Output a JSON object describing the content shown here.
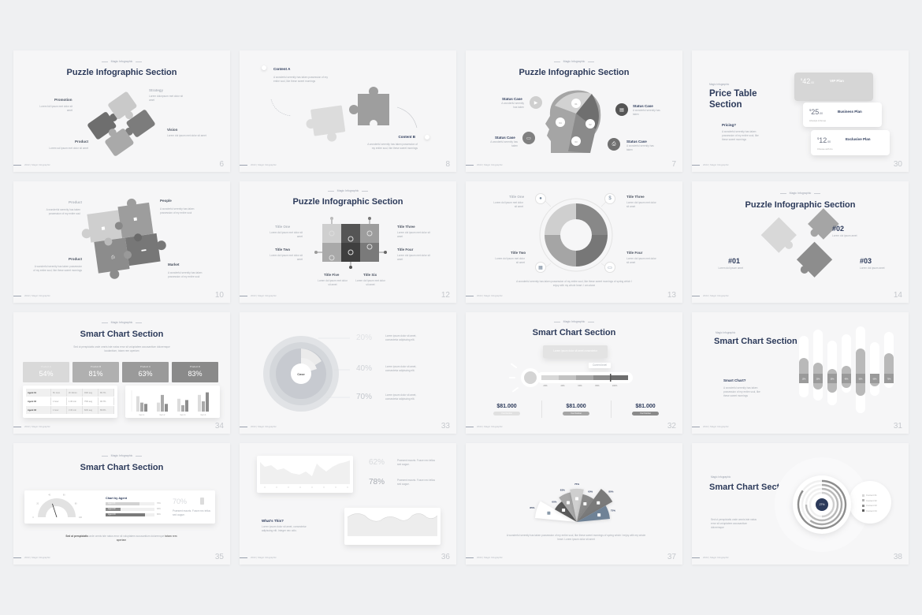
{
  "slides": [
    {
      "page": "6",
      "subtitle": "Magic Infographic",
      "title": "Puzzle Infographic Section",
      "labels": [
        {
          "title": "Promotion",
          "text": "Lorem full ipsum met dolor sit amet"
        },
        {
          "title": "Strategy",
          "text": "Lorem dolorpsum met dolor sit amet"
        },
        {
          "title": "Vision",
          "text": "Lorem dol ipsum met dolor sit amet"
        },
        {
          "title": "Product",
          "text": "Lorem sol ipsum met dolor sit amet"
        }
      ],
      "footer": "2022 | Magic Infographic"
    },
    {
      "page": "8",
      "labels": [
        {
          "title": "Content A",
          "text": "A wonderful serenity has taken possession of my entire soul, like these sweet mornings"
        },
        {
          "title": "Content B",
          "text": "A wonderful serenity has taken possession of my entire soul, like these sweet mornings"
        }
      ],
      "footer": "2022 | Magic Infographic"
    },
    {
      "page": "7",
      "subtitle": "Magic Infographic",
      "title": "Puzzle Infographic Section",
      "labels": [
        {
          "title": "Status Case",
          "text": "A wonderful serenity has taken"
        },
        {
          "title": "Status Case",
          "text": "A wonderful serenity has taken"
        },
        {
          "title": "Status Case",
          "text": "A wonderful serenity has taken"
        },
        {
          "title": "Status Case",
          "text": "A wonderful serenity has taken"
        }
      ],
      "head_numbers": [
        "01",
        "02",
        "03",
        "04"
      ],
      "footer": "2022 | Magic Infographic"
    },
    {
      "page": "30",
      "subtitle": "Magic Infographic",
      "title_line1": "Price Table",
      "title_line2": "Section",
      "question": "Pricing?",
      "text": "A wonderful serenity has taken possession of my entire soul, like these sweet mornings",
      "plans": [
        {
          "currency": "$",
          "price": "42",
          "cents": ".00",
          "name": "VIP Plan",
          "note": "Lifestyle 1/Group"
        },
        {
          "currency": "$",
          "price": "25",
          "cents": ".00",
          "name": "Business Plan",
          "note": "Lifestyle 1/Group"
        },
        {
          "currency": "$",
          "price": "12",
          "cents": ".00",
          "name": "Exclusive Plan",
          "note": "Choose with Us"
        }
      ],
      "footer": "2022 | Magic Infographic"
    },
    {
      "page": "10",
      "labels": [
        {
          "title": "Product",
          "text": "A wonderful serenity has taken possession of my entire soul"
        },
        {
          "title": "People",
          "text": "A wonderful serenity has taken possession of my entire soul"
        },
        {
          "title": "Product",
          "text": "A wonderful serenity has taken possession of my entire soul, like these sweet mornings"
        },
        {
          "title": "Market",
          "text": "A wonderful serenity has taken possession of my entire soul"
        }
      ],
      "footer": "2022 | Magic Infographic"
    },
    {
      "page": "12",
      "subtitle": "Magic Infographic",
      "title": "Puzzle Infographic Section",
      "labels": [
        {
          "title": "Title One",
          "text": "Lorem dol ipsum met dolor sit amet"
        },
        {
          "title": "Title Two",
          "text": "Lorem dol ipsum met dolor sit amet"
        },
        {
          "title": "Title Three",
          "text": "Lorem dol ipsum met dolor sit amet"
        },
        {
          "title": "Title Four",
          "text": "Lorem dol ipsum met dolor sit amet"
        },
        {
          "title": "Title Five",
          "text": "Lorem dol ipsum met dolor sit amet"
        },
        {
          "title": "Title Six",
          "text": "Lorem dol ipsum met dolor sit amet"
        }
      ],
      "footer": "2022 | Magic Infographic"
    },
    {
      "page": "13",
      "labels": [
        {
          "title": "Title One",
          "text": "Lorem dol ipsum met dolor sit amet"
        },
        {
          "title": "Title Two",
          "text": "Lorem dol ipsum met dolor sit amet"
        },
        {
          "title": "Title Three",
          "text": "Lorem dol ipsum met dolor sit amet"
        },
        {
          "title": "Title Four",
          "text": "Lorem dol ipsum met dolor sit amet"
        }
      ],
      "caption": "A wonderful serenity has taken possession of my entire soul, like these sweet mornings of spring which I enjoy with my whole heart. I am alone",
      "footer": "2022 | Magic Infographic"
    },
    {
      "page": "14",
      "subtitle": "Magic Infographic",
      "title": "Puzzle Infographic Section",
      "labels": [
        {
          "title": "#01",
          "text": "Lorem dol ipsum amet"
        },
        {
          "title": "#02",
          "text": "Lorem dol ipsum amet"
        },
        {
          "title": "#03",
          "text": "Lorem dol ipsum amet"
        }
      ],
      "footer": "2022 | Magic Infographic"
    },
    {
      "page": "34",
      "subtitle": "Magic Infographic",
      "title": "Smart Chart Section",
      "text": "Sed ut perspiciatis unde omnis iste natus error sit voluptatem accusantium doloremque laudantium, totam rem aperiam",
      "stats": [
        {
          "label": "Product A",
          "value": "54%"
        },
        {
          "label": "Product B",
          "value": "81%"
        },
        {
          "label": "Product C",
          "value": "63%"
        },
        {
          "label": "Product D",
          "value": "83%"
        }
      ],
      "table_rows": [
        [
          "Agent 01",
          "5h 1min",
          "2h 30min",
          "93% avg",
          "85.7%"
        ],
        [
          "Agent 02",
          "1 hour",
          "1 30 min",
          "75% avg",
          "96.7%"
        ],
        [
          "Agent 03",
          "1 hour",
          "3 30 min",
          "82% avg",
          "89.5%"
        ]
      ],
      "bar_groups": [
        "Item 1",
        "Item 2",
        "Item 3",
        "Item 4"
      ],
      "bar_values": [
        [
          6,
          3.5,
          3
        ],
        [
          3.5,
          6.5,
          3
        ],
        [
          5,
          2.5,
          4.5
        ],
        [
          6.5,
          4,
          7.5
        ]
      ],
      "footer": "2022 | Magic Infographic"
    },
    {
      "page": "33",
      "center_label": "Case",
      "rows": [
        {
          "value": "20%",
          "text": "Lorem ipsum dolor sit amet, consectetur adipiscing elit."
        },
        {
          "value": "40%",
          "text": "Lorem ipsum dolor sit amet, consectetur adipiscing elit."
        },
        {
          "value": "70%",
          "text": "Lorem ipsum dolor sit amet, consectetur adipiscing elit."
        }
      ],
      "footer": "2022 | Magic Infographic"
    },
    {
      "page": "32",
      "subtitle": "Magic Infographic",
      "title": "Smart Chart Section",
      "box_text": "Lorem ipsum dolor sit amet consectetur",
      "tooltip": "Current level",
      "scale": [
        "20%",
        "40%",
        "60%",
        "80%",
        "100%"
      ],
      "level": 0.8,
      "amounts": [
        {
          "value": "$81.000",
          "pill": "Your Number"
        },
        {
          "value": "$81.000",
          "pill": "Your Number"
        },
        {
          "value": "$81.000",
          "pill": "Your Number"
        }
      ],
      "footer": "2022 | Magic Infographic"
    },
    {
      "page": "31",
      "subtitle": "Magic Infographic",
      "title": "Smart Chart  Section",
      "question": "Smart Chart?",
      "text": "A wonderful serenity has taken possession of my entire soul, like these sweet mornings",
      "pill_labels": [
        "10%",
        "20%",
        "30%",
        "40%",
        "50%",
        "60%",
        "70%"
      ],
      "footer": "2022 | Magic Infographic"
    },
    {
      "page": "35",
      "subtitle": "Magic Infographic",
      "title": "Smart Chart Section",
      "gauge_ticks": [
        "0",
        "20",
        "40",
        "60",
        "80",
        "100"
      ],
      "gauge_value": 40,
      "chart_title": "Chart by Agent",
      "agents": [
        {
          "name": "Agent 01",
          "value": "70%",
          "pct": 0.7
        },
        {
          "name": "Agent 02",
          "value": "30%",
          "pct": 0.3
        },
        {
          "name": "Agent 03",
          "value": "80%",
          "pct": 0.8
        }
      ],
      "big_value": "70%",
      "big_text": "Praesent mauris. Fusce nec tellus sed augue.",
      "caption_bold": "Sed ut perspiciatis",
      "caption": "unde omnis iste natus error sit voluptatem accusantium doloremque",
      "caption_end": "totam rem aperiam",
      "footer": "2022 | Magic Infographic"
    },
    {
      "page": "36",
      "stats": [
        {
          "value": "62%",
          "text": "Praesent mauris. Fusce nec tellus sed augue."
        },
        {
          "value": "78%",
          "text": "Praesent mauris. Fusce nec tellus sed augue."
        }
      ],
      "question": "What's This?",
      "text": "Lorem ipsum dolor sit amet, consectetur adipiscing elit. Integer nec odio.",
      "footer": "2022 | Magic Infographic"
    },
    {
      "page": "37",
      "fan": [
        {
          "value": "85%",
          "color": "#ffffff",
          "icon": "briefcase"
        },
        {
          "value": "60%",
          "color": "#5a5a5a",
          "icon": "chart"
        },
        {
          "value": "63%",
          "color": "#a8a8a8",
          "icon": "person"
        },
        {
          "value": "75%",
          "color": "#cfcfcf",
          "icon": "calendar"
        },
        {
          "value": "60%",
          "color": "#8a8a8a",
          "icon": "pie"
        },
        {
          "value": "80%",
          "color": "#7a7a7a",
          "icon": "printer"
        },
        {
          "value": "75%",
          "color": "#6f8296",
          "icon": "building"
        }
      ],
      "caption": "A wonderful serenity has taken possession of my entire soul, like these sweet mornings of spring which I enjoy with my whole heart. Lorem ipsum dolor sit amet",
      "footer": "2022 | Magic Infographic"
    },
    {
      "page": "38",
      "subtitle": "Magic Infographic",
      "title": "Smart Chart  Section",
      "text": "Sed ut perspiciatis unde omnis iste natus error sit voluptatem accusantium doloremque",
      "center_value": "27%",
      "legend": [
        "Content 01",
        "Content 02",
        "Content 03",
        "Content 04"
      ],
      "rings": [
        0.85,
        0.6,
        0.75,
        0.5
      ],
      "footer": "2022 | Magic Infographic"
    }
  ],
  "colors": {
    "title": "#2c3a5a",
    "background": "#eff0f2",
    "slide": "#f6f6f7",
    "accent_blue": "#2c3a5a",
    "slate": "#6f8296"
  }
}
